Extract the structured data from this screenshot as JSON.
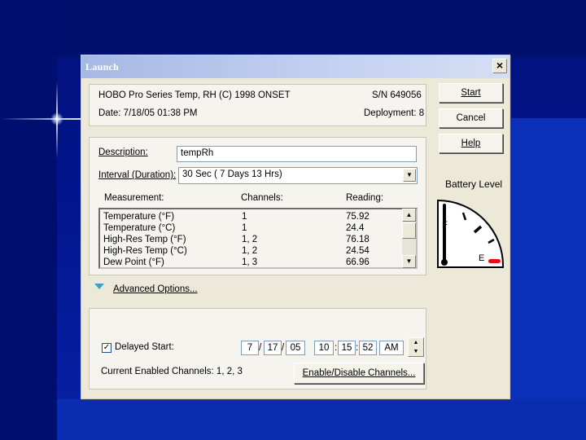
{
  "dialog": {
    "title": "Launch",
    "close_glyph": "×"
  },
  "info": {
    "device": "HOBO Pro Series Temp, RH (C) 1998 ONSET",
    "serial": "S/N 649056",
    "date": "Date:  7/18/05 01:38 PM",
    "deployment": "Deployment: 8"
  },
  "buttons": {
    "start": "Start",
    "cancel": "Cancel",
    "help": "Help",
    "enable_disable": "Enable/Disable Channels..."
  },
  "battery": {
    "label": "Battery Level",
    "full_mark": "F",
    "empty_mark": "E",
    "level_fraction": 1.0,
    "empty_color": "#e01010"
  },
  "form": {
    "description_label": "Description:",
    "description_value": "tempRh",
    "interval_label": "Interval (Duration):",
    "interval_value": "30 Sec ( 7 Days 13 Hrs)"
  },
  "table": {
    "headers": [
      "Measurement:",
      "Channels:",
      "Reading:"
    ],
    "rows": [
      [
        "Temperature (°F)",
        "1",
        "75.92"
      ],
      [
        "Temperature (°C)",
        "1",
        "24.4"
      ],
      [
        "High-Res Temp (°F)",
        "1, 2",
        "76.18"
      ],
      [
        "High-Res Temp (°C)",
        "1, 2",
        "24.54"
      ],
      [
        "Dew Point (°F)",
        "1, 3",
        "66.96"
      ]
    ]
  },
  "advanced": {
    "label": "Advanced Options...",
    "icon": "triangle-down-icon"
  },
  "delayed": {
    "checked": true,
    "check_glyph": "✓",
    "label": "Delayed Start:",
    "month": "7",
    "day": "17",
    "year": "05",
    "hour": "10",
    "minute": "15",
    "second": "52",
    "ampm": "AM",
    "date_sep": "/",
    "time_sep": ":"
  },
  "channels": {
    "label": "Current Enabled Channels:  1, 2, 3"
  },
  "scroll_glyphs": {
    "up": "▲",
    "down": "▼"
  }
}
